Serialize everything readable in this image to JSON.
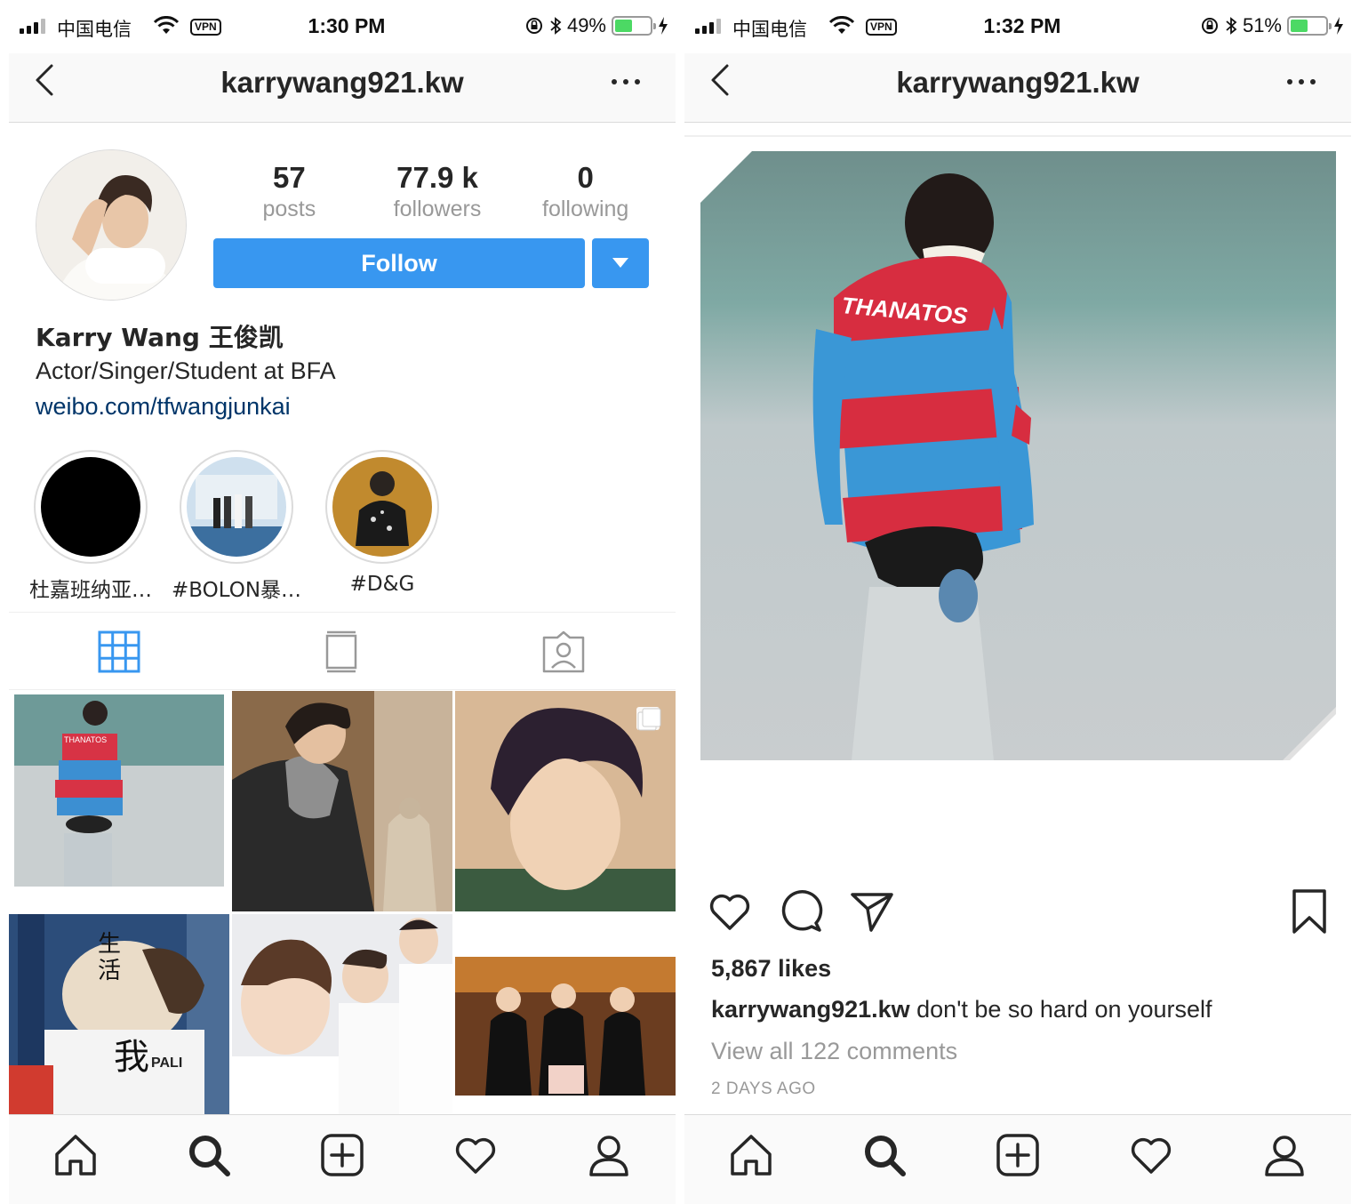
{
  "left_screen": {
    "status": {
      "carrier": "中国电信",
      "vpn": "VPN",
      "time": "1:30 PM",
      "battery": "49%",
      "battery_level": 0.49
    },
    "nav": {
      "title": "karrywang921.kw"
    },
    "stats": [
      {
        "num": "57",
        "label": "posts"
      },
      {
        "num": "77.9 k",
        "label": "followers"
      },
      {
        "num": "0",
        "label": "following"
      }
    ],
    "follow_label": "Follow",
    "bio": {
      "name": "Karry Wang 王俊凯",
      "text": "Actor/Singer/Student at BFA",
      "link": "weibo.com/tfwangjunkai"
    },
    "highlights": [
      {
        "label": "杜嘉班纳亚…"
      },
      {
        "label": "#BOLON暴…"
      },
      {
        "label": "#D&G"
      }
    ],
    "grid_overlay_text": {
      "cell4_char1": "生",
      "cell4_char2": "活",
      "cell4_big": "我",
      "cell4_brand": "PALI"
    }
  },
  "right_screen": {
    "status": {
      "carrier": "中国电信",
      "vpn": "VPN",
      "time": "1:32 PM",
      "battery": "51%",
      "battery_level": 0.51
    },
    "nav": {
      "title": "karrywang921.kw"
    },
    "image_text": "THANATOS",
    "likes": "5,867 likes",
    "caption_user": "karrywang921.kw",
    "caption_text": " don't be so hard on yourself",
    "view_comments": "View all 122 comments",
    "time_ago": "2 DAYS AGO"
  },
  "colors": {
    "accent": "#3897f0",
    "link": "#003569",
    "muted": "#999999",
    "text": "#262626"
  }
}
